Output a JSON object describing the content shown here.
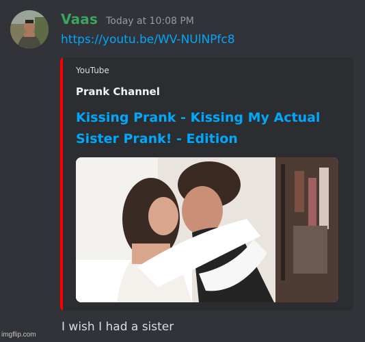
{
  "author": {
    "username": "Vaas",
    "timestamp": "Today at 10:08 PM"
  },
  "message": {
    "link": "https://youtu.be/WV-NUlNPfc8",
    "text": "I wish I had a sister"
  },
  "embed": {
    "provider": "YouTube",
    "channel": "Prank Channel",
    "title": "Kissing Prank - Kissing My Actual Sister Prank! - Edition",
    "accent_color": "#ff0000"
  },
  "watermark": "imgflip.com",
  "colors": {
    "background": "#313338",
    "username": "#3ba55c",
    "link": "#00a8fc",
    "embed_bg": "#2b2d31"
  }
}
